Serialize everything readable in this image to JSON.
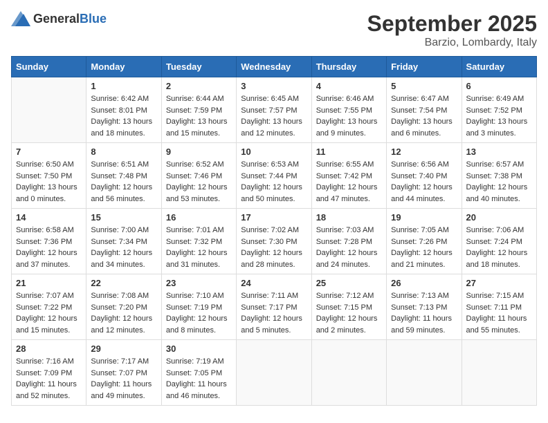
{
  "header": {
    "logo_general": "General",
    "logo_blue": "Blue",
    "title": "September 2025",
    "subtitle": "Barzio, Lombardy, Italy"
  },
  "days_of_week": [
    "Sunday",
    "Monday",
    "Tuesday",
    "Wednesday",
    "Thursday",
    "Friday",
    "Saturday"
  ],
  "weeks": [
    [
      {
        "day": "",
        "sunrise": "",
        "sunset": "",
        "daylight": ""
      },
      {
        "day": "1",
        "sunrise": "Sunrise: 6:42 AM",
        "sunset": "Sunset: 8:01 PM",
        "daylight": "Daylight: 13 hours and 18 minutes."
      },
      {
        "day": "2",
        "sunrise": "Sunrise: 6:44 AM",
        "sunset": "Sunset: 7:59 PM",
        "daylight": "Daylight: 13 hours and 15 minutes."
      },
      {
        "day": "3",
        "sunrise": "Sunrise: 6:45 AM",
        "sunset": "Sunset: 7:57 PM",
        "daylight": "Daylight: 13 hours and 12 minutes."
      },
      {
        "day": "4",
        "sunrise": "Sunrise: 6:46 AM",
        "sunset": "Sunset: 7:55 PM",
        "daylight": "Daylight: 13 hours and 9 minutes."
      },
      {
        "day": "5",
        "sunrise": "Sunrise: 6:47 AM",
        "sunset": "Sunset: 7:54 PM",
        "daylight": "Daylight: 13 hours and 6 minutes."
      },
      {
        "day": "6",
        "sunrise": "Sunrise: 6:49 AM",
        "sunset": "Sunset: 7:52 PM",
        "daylight": "Daylight: 13 hours and 3 minutes."
      }
    ],
    [
      {
        "day": "7",
        "sunrise": "Sunrise: 6:50 AM",
        "sunset": "Sunset: 7:50 PM",
        "daylight": "Daylight: 13 hours and 0 minutes."
      },
      {
        "day": "8",
        "sunrise": "Sunrise: 6:51 AM",
        "sunset": "Sunset: 7:48 PM",
        "daylight": "Daylight: 12 hours and 56 minutes."
      },
      {
        "day": "9",
        "sunrise": "Sunrise: 6:52 AM",
        "sunset": "Sunset: 7:46 PM",
        "daylight": "Daylight: 12 hours and 53 minutes."
      },
      {
        "day": "10",
        "sunrise": "Sunrise: 6:53 AM",
        "sunset": "Sunset: 7:44 PM",
        "daylight": "Daylight: 12 hours and 50 minutes."
      },
      {
        "day": "11",
        "sunrise": "Sunrise: 6:55 AM",
        "sunset": "Sunset: 7:42 PM",
        "daylight": "Daylight: 12 hours and 47 minutes."
      },
      {
        "day": "12",
        "sunrise": "Sunrise: 6:56 AM",
        "sunset": "Sunset: 7:40 PM",
        "daylight": "Daylight: 12 hours and 44 minutes."
      },
      {
        "day": "13",
        "sunrise": "Sunrise: 6:57 AM",
        "sunset": "Sunset: 7:38 PM",
        "daylight": "Daylight: 12 hours and 40 minutes."
      }
    ],
    [
      {
        "day": "14",
        "sunrise": "Sunrise: 6:58 AM",
        "sunset": "Sunset: 7:36 PM",
        "daylight": "Daylight: 12 hours and 37 minutes."
      },
      {
        "day": "15",
        "sunrise": "Sunrise: 7:00 AM",
        "sunset": "Sunset: 7:34 PM",
        "daylight": "Daylight: 12 hours and 34 minutes."
      },
      {
        "day": "16",
        "sunrise": "Sunrise: 7:01 AM",
        "sunset": "Sunset: 7:32 PM",
        "daylight": "Daylight: 12 hours and 31 minutes."
      },
      {
        "day": "17",
        "sunrise": "Sunrise: 7:02 AM",
        "sunset": "Sunset: 7:30 PM",
        "daylight": "Daylight: 12 hours and 28 minutes."
      },
      {
        "day": "18",
        "sunrise": "Sunrise: 7:03 AM",
        "sunset": "Sunset: 7:28 PM",
        "daylight": "Daylight: 12 hours and 24 minutes."
      },
      {
        "day": "19",
        "sunrise": "Sunrise: 7:05 AM",
        "sunset": "Sunset: 7:26 PM",
        "daylight": "Daylight: 12 hours and 21 minutes."
      },
      {
        "day": "20",
        "sunrise": "Sunrise: 7:06 AM",
        "sunset": "Sunset: 7:24 PM",
        "daylight": "Daylight: 12 hours and 18 minutes."
      }
    ],
    [
      {
        "day": "21",
        "sunrise": "Sunrise: 7:07 AM",
        "sunset": "Sunset: 7:22 PM",
        "daylight": "Daylight: 12 hours and 15 minutes."
      },
      {
        "day": "22",
        "sunrise": "Sunrise: 7:08 AM",
        "sunset": "Sunset: 7:20 PM",
        "daylight": "Daylight: 12 hours and 12 minutes."
      },
      {
        "day": "23",
        "sunrise": "Sunrise: 7:10 AM",
        "sunset": "Sunset: 7:19 PM",
        "daylight": "Daylight: 12 hours and 8 minutes."
      },
      {
        "day": "24",
        "sunrise": "Sunrise: 7:11 AM",
        "sunset": "Sunset: 7:17 PM",
        "daylight": "Daylight: 12 hours and 5 minutes."
      },
      {
        "day": "25",
        "sunrise": "Sunrise: 7:12 AM",
        "sunset": "Sunset: 7:15 PM",
        "daylight": "Daylight: 12 hours and 2 minutes."
      },
      {
        "day": "26",
        "sunrise": "Sunrise: 7:13 AM",
        "sunset": "Sunset: 7:13 PM",
        "daylight": "Daylight: 11 hours and 59 minutes."
      },
      {
        "day": "27",
        "sunrise": "Sunrise: 7:15 AM",
        "sunset": "Sunset: 7:11 PM",
        "daylight": "Daylight: 11 hours and 55 minutes."
      }
    ],
    [
      {
        "day": "28",
        "sunrise": "Sunrise: 7:16 AM",
        "sunset": "Sunset: 7:09 PM",
        "daylight": "Daylight: 11 hours and 52 minutes."
      },
      {
        "day": "29",
        "sunrise": "Sunrise: 7:17 AM",
        "sunset": "Sunset: 7:07 PM",
        "daylight": "Daylight: 11 hours and 49 minutes."
      },
      {
        "day": "30",
        "sunrise": "Sunrise: 7:19 AM",
        "sunset": "Sunset: 7:05 PM",
        "daylight": "Daylight: 11 hours and 46 minutes."
      },
      {
        "day": "",
        "sunrise": "",
        "sunset": "",
        "daylight": ""
      },
      {
        "day": "",
        "sunrise": "",
        "sunset": "",
        "daylight": ""
      },
      {
        "day": "",
        "sunrise": "",
        "sunset": "",
        "daylight": ""
      },
      {
        "day": "",
        "sunrise": "",
        "sunset": "",
        "daylight": ""
      }
    ]
  ]
}
